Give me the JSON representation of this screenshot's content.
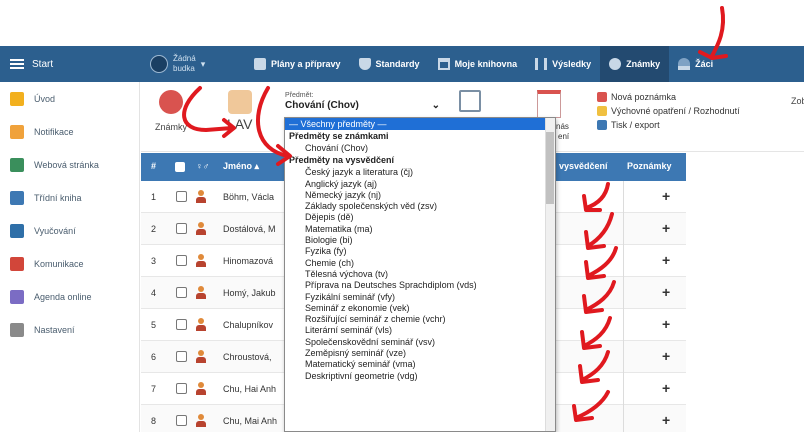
{
  "topbar": {
    "start_label": "Start",
    "school_line1": "Žádná",
    "school_line2": "budka",
    "nav": [
      {
        "label": "Plány a přípravy"
      },
      {
        "label": "Standardy"
      },
      {
        "label": "Moje knihovna"
      },
      {
        "label": "Výsledky"
      },
      {
        "label": "Známky"
      },
      {
        "label": "Žáci"
      }
    ]
  },
  "sidebar": {
    "items": [
      {
        "label": "Úvod",
        "color": "#f2b01e"
      },
      {
        "label": "Notifikace",
        "color": "#f0a23b"
      },
      {
        "label": "Webová stránka",
        "color": "#3a8f5c"
      },
      {
        "label": "Třídní kniha",
        "color": "#3d78b3"
      },
      {
        "label": "Vyučování",
        "color": "#2f6fa8"
      },
      {
        "label": "Komunikace",
        "color": "#d2463a"
      },
      {
        "label": "Agenda online",
        "color": "#7b6cc4"
      },
      {
        "label": "Nastavení",
        "color": "#8a8a8a"
      }
    ]
  },
  "toolbar": {
    "grades_label": "Známky",
    "class_label": "LAV",
    "subject_label": "Předmět:",
    "subject_value": "Chování (Chov)",
    "caption_a": "nás",
    "caption_b": "ení",
    "new_note": "Nová poznámka",
    "edu_measure": "Výchovné opatření / Rozhodnutí",
    "print_export": "Tisk / export",
    "tail": "Zob"
  },
  "table": {
    "headers": {
      "num": "#",
      "sex": "♀♂",
      "name": "Jméno ▴",
      "cert": "vysvědčení",
      "notes": "Poznámky"
    },
    "rows": [
      {
        "num": "1",
        "name": "Böhm, Václa"
      },
      {
        "num": "2",
        "name": "Dostálová, M"
      },
      {
        "num": "3",
        "name": "Hinomazová"
      },
      {
        "num": "4",
        "name": "Homý, Jakub"
      },
      {
        "num": "5",
        "name": "Chalupníkov"
      },
      {
        "num": "6",
        "name": "Chroustová,"
      },
      {
        "num": "7",
        "name": "Chu, Hai Anh"
      },
      {
        "num": "8",
        "name": "Chu, Mai Anh"
      }
    ]
  },
  "dropdown": {
    "selected": "— Všechny předměty —",
    "group1": "Předměty se známkami",
    "group1_options": [
      "Chování (Chov)"
    ],
    "group2": "Předměty na vysvědčení",
    "group2_options": [
      "Český jazyk a literatura (čj)",
      "Anglický jazyk (aj)",
      "Německý jazyk (nj)",
      "Základy společenských věd (zsv)",
      "Dějepis (dě)",
      "Matematika (ma)",
      "Biologie (bi)",
      "Fyzika (fy)",
      "Chemie (ch)",
      "Tělesná výchova (tv)",
      "Příprava na Deutsches Sprachdiplom (vds)",
      "Fyzikální seminář (vfy)",
      "Seminář z ekonomie (vek)",
      "Rozšiřující seminář z chemie (vchr)",
      "Literární seminář (vls)",
      "Společenskovědní seminář (vsv)",
      "Zeměpisný seminář (vze)",
      "Matematický seminář (vma)",
      "Deskriptivní geometrie (vdg)"
    ]
  },
  "colors": {
    "nav": "#2c5f8e",
    "table_head": "#3d78b3",
    "annotation": "#e0191f",
    "selected": "#1f6fd6"
  }
}
